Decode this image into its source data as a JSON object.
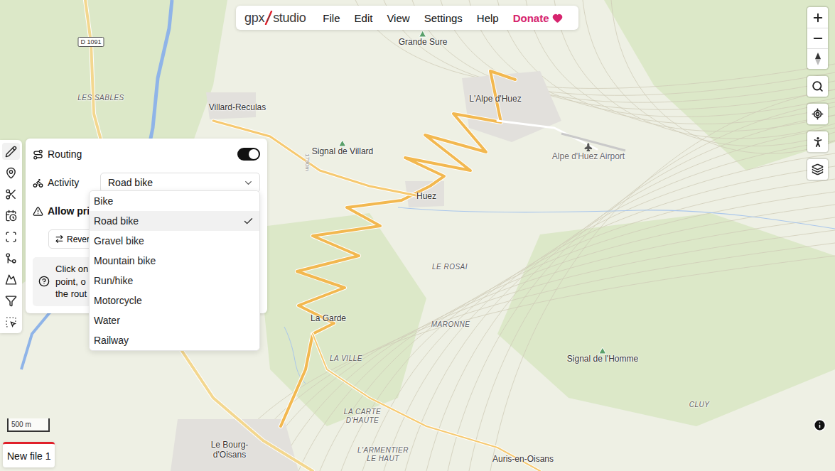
{
  "app": {
    "logo": [
      "gpx",
      "studio"
    ],
    "menu": [
      "File",
      "Edit",
      "View",
      "Settings",
      "Help"
    ],
    "donate": "Donate"
  },
  "tools": [
    {
      "kind": "route",
      "selected": true
    },
    {
      "kind": "poi",
      "selected": false
    },
    {
      "kind": "scissors",
      "selected": false
    },
    {
      "kind": "time",
      "selected": false
    },
    {
      "kind": "scan",
      "selected": false
    },
    {
      "kind": "merge",
      "selected": false
    },
    {
      "kind": "elevation",
      "selected": false
    },
    {
      "kind": "filter",
      "selected": false
    },
    {
      "kind": "select",
      "selected": false
    }
  ],
  "panel": {
    "routing": {
      "label": "Routing",
      "on": true
    },
    "activity": {
      "label": "Activity",
      "value": "Road bike",
      "expanded": true
    },
    "warning": "Allow pri",
    "reverse": "Revers",
    "help": [
      "Click on",
      "point, o",
      "the rout"
    ]
  },
  "dropdown": [
    {
      "label": "Bike",
      "selected": false
    },
    {
      "label": "Road bike",
      "selected": true
    },
    {
      "label": "Gravel bike",
      "selected": false
    },
    {
      "label": "Mountain bike",
      "selected": false
    },
    {
      "label": "Run/hike",
      "selected": false
    },
    {
      "label": "Motorcycle",
      "selected": false
    },
    {
      "label": "Water",
      "selected": false
    },
    {
      "label": "Railway",
      "selected": false
    }
  ],
  "scale": "500 m",
  "file_tab": {
    "label": "New file 1",
    "selected": true
  },
  "map": {
    "labels": [
      {
        "lines": [
          "D 1091"
        ],
        "kind": "road"
      },
      {
        "lines": [
          "LES SABLES"
        ],
        "kind": "locality"
      },
      {
        "lines": [
          "Villard-Reculas"
        ],
        "kind": "town"
      },
      {
        "lines": [
          "Grande Sure"
        ],
        "kind": "peak"
      },
      {
        "lines": [
          "L'Alpe d'Huez"
        ],
        "kind": "town"
      },
      {
        "lines": [
          "Alpe d'Huez Airport"
        ],
        "kind": "airport"
      },
      {
        "lines": [
          "Signal de Villard"
        ],
        "kind": "peak"
      },
      {
        "lines": [
          "1790m"
        ],
        "kind": "contour"
      },
      {
        "lines": [
          "Huez"
        ],
        "kind": "town"
      },
      {
        "lines": [
          "LE ROSAI"
        ],
        "kind": "locality"
      },
      {
        "lines": [
          "La Garde"
        ],
        "kind": "town"
      },
      {
        "lines": [
          "MARONNE"
        ],
        "kind": "locality"
      },
      {
        "lines": [
          "LA VILLE"
        ],
        "kind": "locality"
      },
      {
        "lines": [
          "Signal de l'Homme"
        ],
        "kind": "peak"
      },
      {
        "lines": [
          "CLUY"
        ],
        "kind": "locality"
      },
      {
        "lines": [
          "LA CARTE",
          "D'HAUTE"
        ],
        "kind": "locality"
      },
      {
        "lines": [
          "L'ARMENTIER",
          "LE HAUT"
        ],
        "kind": "locality"
      },
      {
        "lines": [
          "Le Bourg-",
          "d'Oisans"
        ],
        "kind": "town"
      },
      {
        "lines": [
          "Auris-en-Oisans"
        ],
        "kind": "town"
      }
    ]
  }
}
